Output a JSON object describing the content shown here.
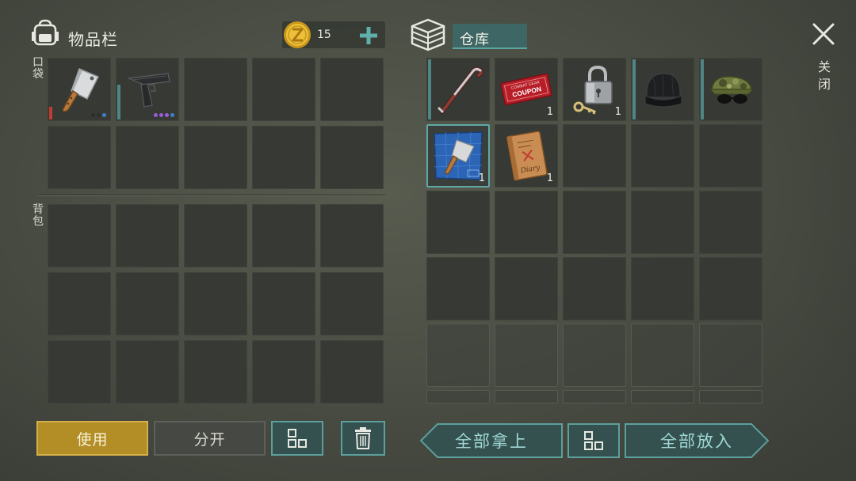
{
  "inventory": {
    "title": "物品栏",
    "coins": "15",
    "pocket_label": "口袋",
    "backpack_label": "背包",
    "pocket_items": [
      {
        "name": "cleaver",
        "icon": "cleaver-icon"
      },
      {
        "name": "pistol",
        "icon": "pistol-icon"
      }
    ]
  },
  "warehouse": {
    "title": "仓库",
    "items": [
      {
        "icon": "crowbar-icon",
        "qty": ""
      },
      {
        "icon": "coupon-icon",
        "qty": "1",
        "text_top": "COMBAT GEAR",
        "text_main": "COUPON"
      },
      {
        "icon": "padlock-icon",
        "qty": "1"
      },
      {
        "icon": "beanie-icon",
        "qty": ""
      },
      {
        "icon": "camo-cap-icon",
        "qty": ""
      },
      {
        "icon": "blueprint-cleaver-icon",
        "qty": "1"
      },
      {
        "icon": "diary-icon",
        "qty": "1",
        "text": "Diary"
      }
    ]
  },
  "close_label": "关闭",
  "buttons": {
    "use": "使用",
    "split": "分开",
    "take_all": "全部拿上",
    "put_all": "全部放入"
  },
  "colors": {
    "accent_teal": "#5fa8a6",
    "use_gold": "#b38e26",
    "coin_gold": "#e2b42c"
  }
}
